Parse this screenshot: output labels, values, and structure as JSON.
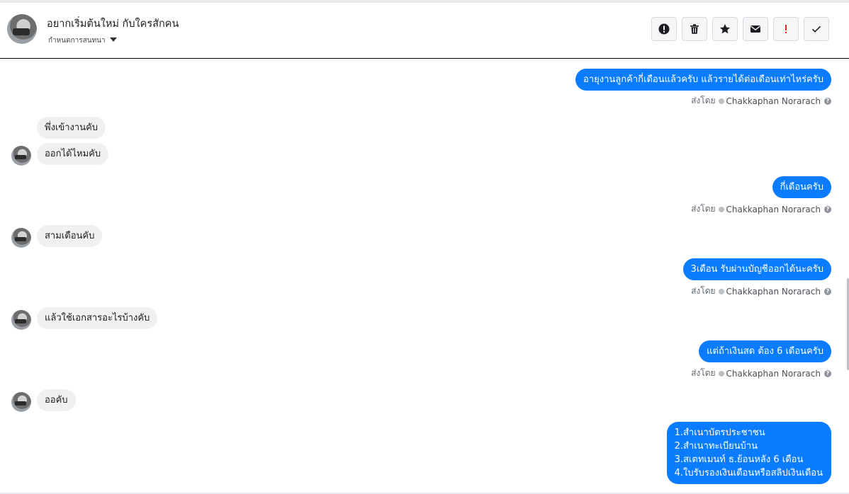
{
  "header": {
    "title": "อยากเริ่มต้นใหม่ กับใครสักคน",
    "subtitle": "กำหนดการสนทนา",
    "actions": [
      {
        "name": "report-icon"
      },
      {
        "name": "trash-icon"
      },
      {
        "name": "star-icon"
      },
      {
        "name": "envelope-icon"
      },
      {
        "name": "exclamation-icon",
        "color": "#e02424"
      },
      {
        "name": "checkmark-icon"
      }
    ]
  },
  "colors": {
    "outgoing_bubble": "#0a7cff",
    "incoming_bubble": "#f0f0f0"
  },
  "thread": {
    "sent_by_label": "ส่งโดย",
    "sender_name": "Chakkaphan Norarach",
    "help_glyph": "?",
    "messages": [
      {
        "dir": "out",
        "text": "อายุงานลูกค้ากี่เดือนแล้วครับ แล้วรายได้ต่อเดือนเท่าไหร่ครับ"
      },
      {
        "dir": "in",
        "text": "พึ่งเข้างานคับ"
      },
      {
        "dir": "in",
        "text": "ออกได้ไหมคับ"
      },
      {
        "dir": "out",
        "text": "กี่เดือนครับ"
      },
      {
        "dir": "in",
        "text": "สามเดือนคับ"
      },
      {
        "dir": "out",
        "text": "3เดือน รับผ่านบัญชีออกได้นะครับ"
      },
      {
        "dir": "in",
        "text": "แล้วใช้เอกสารอะไรบ้างคับ"
      },
      {
        "dir": "out",
        "text": "แต่ถ้าเงินสด ต้อง 6 เดือนครับ"
      },
      {
        "dir": "in",
        "text": "ออคับ"
      },
      {
        "dir": "out",
        "lines": [
          "1.สำเนาบัตรประชาชน",
          "2.สำเนาทะเบียนบ้าน",
          "3.สเตทเมนท์ ธ.ย้อนหลัง 6 เดือน",
          "4.ใบรับรองเงินเดือนหรือสลิปเงินเดือน"
        ]
      }
    ]
  }
}
